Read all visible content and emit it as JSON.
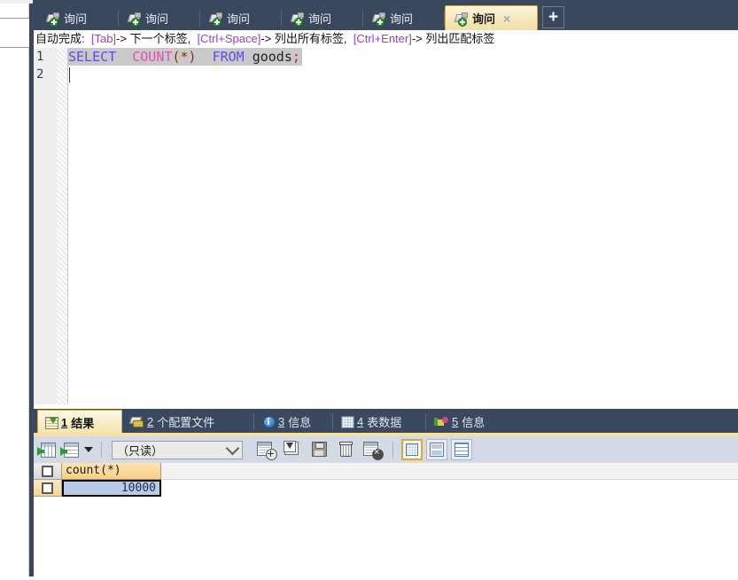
{
  "app": {
    "title": "HeidiSQL Query Editor",
    "language": "zh-CN"
  },
  "sidebar": {
    "item_label": ""
  },
  "query_tabs": {
    "tabs": [
      {
        "label": "询问",
        "icon": "query-plug-icon",
        "active": false
      },
      {
        "label": "询问",
        "icon": "query-plug-icon",
        "active": false
      },
      {
        "label": "询问",
        "icon": "query-plug-icon",
        "active": false
      },
      {
        "label": "询问",
        "icon": "query-plug-icon",
        "active": false
      },
      {
        "label": "询问",
        "icon": "query-plug-icon",
        "active": false
      },
      {
        "label": "询问",
        "icon": "query-plug-icon",
        "active": true
      }
    ],
    "close_glyph": "×",
    "add_label": "+"
  },
  "hint": {
    "prefix": "自动完成:",
    "segments": [
      {
        "key": "[Tab]",
        "text": "-> 下一个标签,"
      },
      {
        "key": "[Ctrl+Space]",
        "text": "-> 列出所有标签,"
      },
      {
        "key": "[Ctrl+Enter]",
        "text": "-> 列出匹配标签"
      }
    ],
    "full_text": "自动完成:  [Tab]-> 下一个标签,  [Ctrl+Space]-> 列出所有标签,  [Ctrl+Enter]-> 列出匹配标签"
  },
  "editor": {
    "line_numbers": [
      "1",
      "2"
    ],
    "sql": {
      "tokens": [
        {
          "t": "SELECT",
          "cls": "kw"
        },
        {
          "t": "  ",
          "cls": "plain"
        },
        {
          "t": "COUNT",
          "cls": "fn"
        },
        {
          "t": "(",
          "cls": "paren"
        },
        {
          "t": "*",
          "cls": "paren"
        },
        {
          "t": ")",
          "cls": "paren"
        },
        {
          "t": "  ",
          "cls": "plain"
        },
        {
          "t": "FROM",
          "cls": "kw"
        },
        {
          "t": " ",
          "cls": "plain"
        },
        {
          "t": "goods",
          "cls": "ident"
        },
        {
          "t": ";",
          "cls": "semi"
        }
      ],
      "plain_text": "SELECT  COUNT(*)  FROM goods;"
    },
    "colors": {
      "keyword": "#5a4fe0",
      "function": "#e84fb0",
      "paren": "#8c2b1f",
      "identifier": "#222222",
      "semicolon": "#cc2222",
      "line_highlight": "#c9c9c9"
    }
  },
  "result_tabs": {
    "tabs": [
      {
        "num": "1",
        "label": "结果",
        "icon": "result-grid-icon",
        "active": true
      },
      {
        "num": "2",
        "label": "个配置文件",
        "icon": "profile-icon",
        "active": false
      },
      {
        "num": "3",
        "label": "信息",
        "icon": "info-icon",
        "active": false
      },
      {
        "num": "4",
        "label": "表数据",
        "icon": "table-data-icon",
        "active": false
      },
      {
        "num": "5",
        "label": "信息",
        "icon": "chart-info-icon",
        "active": false
      }
    ]
  },
  "result_toolbar": {
    "buttons": [
      {
        "name": "show-all-rows",
        "icon": "grid-import-icon"
      },
      {
        "name": "next-rows",
        "icon": "grid-next-icon"
      },
      {
        "name": "rows-dropdown",
        "icon": "chevron-down-icon"
      }
    ],
    "mode_select": {
      "value": "（只读）",
      "options": [
        "（只读）"
      ]
    },
    "actions": [
      {
        "name": "insert-row-button",
        "icon": "add-record-icon"
      },
      {
        "name": "refresh-button",
        "icon": "refresh-icon"
      },
      {
        "name": "save-button",
        "icon": "floppy-save-icon"
      },
      {
        "name": "delete-row-button",
        "icon": "trash-icon"
      },
      {
        "name": "cancel-changes-button",
        "icon": "cancel-record-icon"
      }
    ],
    "views": [
      {
        "name": "grid-view-button",
        "icon": "grid-view-icon",
        "selected": true
      },
      {
        "name": "form-view-button",
        "icon": "split-view-icon",
        "selected": false
      },
      {
        "name": "text-view-button",
        "icon": "text-view-icon",
        "selected": false
      }
    ]
  },
  "result_grid": {
    "columns": [
      "count(*)"
    ],
    "rows": [
      {
        "cells": [
          "10000"
        ],
        "selected": true
      }
    ]
  },
  "colors": {
    "tabstrip_navy": "#39475f",
    "active_tab_cream": "#f7e7bb",
    "toolbar_bg": "#d3dae5",
    "col_header_orange": "#f6cf85",
    "selected_cell_blue": "#b7cbe8",
    "yellow_divider": "#f7dfa0"
  }
}
